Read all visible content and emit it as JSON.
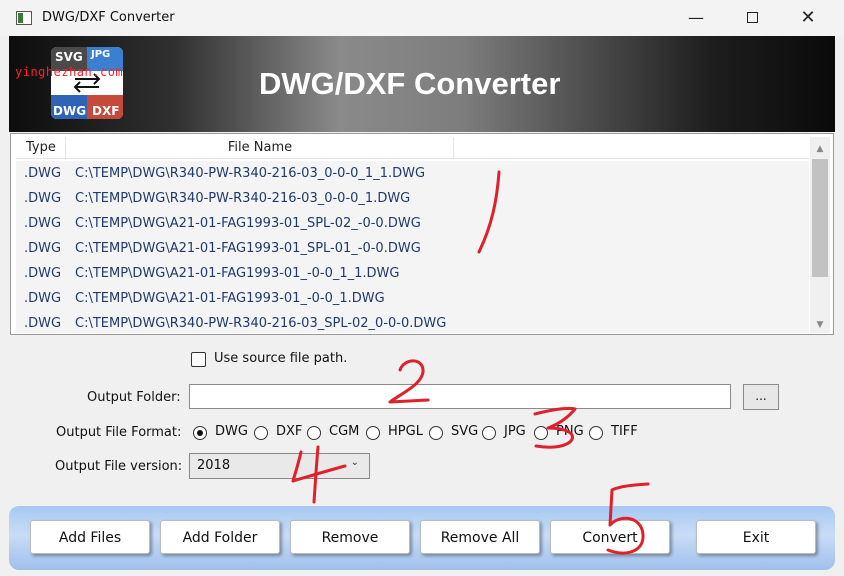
{
  "window": {
    "title": "DWG/DXF Converter",
    "minimize": "—",
    "close": "✕"
  },
  "banner": {
    "title": "DWG/DXF Converter",
    "watermark": "yinghezhan.com",
    "logo": {
      "tl": "SVG",
      "tr": "JPG",
      "bl": "DWG",
      "br": "DXF"
    }
  },
  "file_list": {
    "columns": [
      "Type",
      "File Name"
    ],
    "rows": [
      {
        "type": ".DWG",
        "name": "C:\\TEMP\\DWG\\R340-PW-R340-216-03_0-0-0_1_1.DWG"
      },
      {
        "type": ".DWG",
        "name": "C:\\TEMP\\DWG\\R340-PW-R340-216-03_0-0-0_1.DWG"
      },
      {
        "type": ".DWG",
        "name": "C:\\TEMP\\DWG\\A21-01-FAG1993-01_SPL-02_-0-0.DWG"
      },
      {
        "type": ".DWG",
        "name": "C:\\TEMP\\DWG\\A21-01-FAG1993-01_SPL-01_-0-0.DWG"
      },
      {
        "type": ".DWG",
        "name": "C:\\TEMP\\DWG\\A21-01-FAG1993-01_-0-0_1_1.DWG"
      },
      {
        "type": ".DWG",
        "name": "C:\\TEMP\\DWG\\A21-01-FAG1993-01_-0-0_1.DWG"
      },
      {
        "type": ".DWG",
        "name": "C:\\TEMP\\DWG\\R340-PW-R340-216-03_SPL-02_0-0-0.DWG"
      }
    ]
  },
  "options": {
    "use_source_label": "Use source file path.",
    "use_source_checked": false,
    "output_folder_label": "Output Folder:",
    "output_folder_value": "",
    "browse_label": "...",
    "format_label": "Output File Format:",
    "formats": [
      "DWG",
      "DXF",
      "CGM",
      "HPGL",
      "SVG",
      "JPG",
      "PNG",
      "TIFF"
    ],
    "selected_format": "DWG",
    "version_label": "Output File version:",
    "version_value": "2018"
  },
  "buttons": {
    "add_files": "Add Files",
    "add_folder": "Add Folder",
    "remove": "Remove",
    "remove_all": "Remove All",
    "convert": "Convert",
    "exit": "Exit"
  },
  "annotations": [
    "1",
    "2",
    "3",
    "4",
    "5"
  ],
  "colors": {
    "annotation": "#e0202a",
    "button_bar": "#b4d0f4",
    "row_text": "#1f3a6e"
  }
}
